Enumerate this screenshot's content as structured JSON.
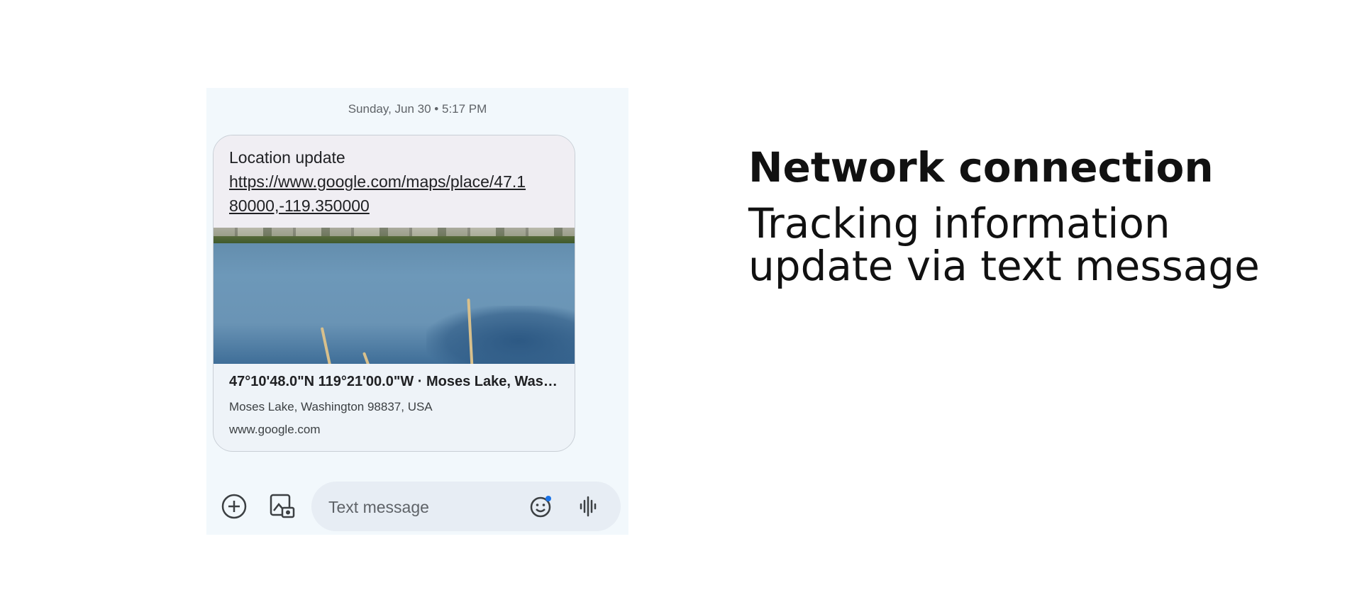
{
  "conversation": {
    "timestamp": "Sunday, Jun 30 • 5:17 PM",
    "message_text": "Location update",
    "message_link": "https://www.google.com/maps/place/47.180000,-119.350000",
    "preview": {
      "title": "47°10'48.0\"N 119°21'00.0\"W · Moses Lake, Washin...",
      "subtitle": "Moses Lake, Washington 98837, USA",
      "domain": "www.google.com"
    }
  },
  "composer": {
    "placeholder": "Text message",
    "icons": [
      "add-circle-icon",
      "gallery-icon",
      "emoji-icon",
      "voice-icon"
    ]
  },
  "side_text": {
    "heading": "Network connection",
    "subheading": "Tracking information update via text message"
  },
  "colors": {
    "chat_background": "#f2f8fc",
    "bubble_top": "#f0eef3",
    "input_pill": "#e7edf4",
    "notification_dot": "#1a73e8"
  }
}
